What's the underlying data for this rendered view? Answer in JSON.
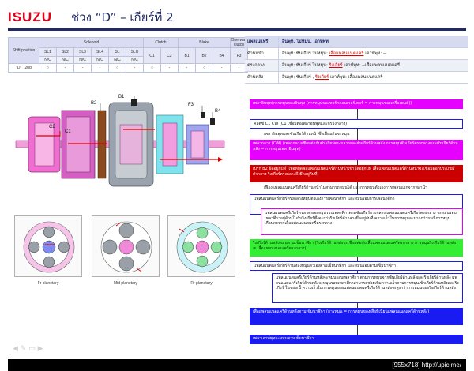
{
  "header": {
    "logo": "ISUZU",
    "title": "ช่วง “D” – เกียร์ที่ 2"
  },
  "shift_table": {
    "shift_position_label": "Shift position",
    "groups": {
      "solenoid": "Solenoid",
      "clutch": "Clutch",
      "blake": "Blake",
      "oneway": "One-way clutch"
    },
    "sub_solenoids": [
      "SL1",
      "SL2",
      "SL3",
      "SL4",
      "SL",
      "SLU"
    ],
    "sub_clutch": [
      "C1",
      "C2"
    ],
    "sub_blake": [
      "B1",
      "B2",
      "B4"
    ],
    "sub_oneway": [
      "F3"
    ],
    "nc_row": [
      "N/C",
      "N/C",
      "N/C",
      "N/C",
      "N/C",
      "N/C"
    ],
    "row": {
      "pos": "\"D\"",
      "gear": "2nd",
      "cells": [
        "○",
        "-",
        "-",
        "-",
        "○",
        "-",
        "○",
        "-",
        "-",
        "○",
        "-",
        "-"
      ]
    }
  },
  "diagram": {
    "labels": [
      "B2",
      "B1",
      "F3",
      "B4",
      "C2",
      "C1"
    ],
    "captions": [
      "Fr planetary",
      "Mid planetary",
      "Rr planetary"
    ]
  },
  "right_table": {
    "head": {
      "k": "แพลเนแทรี",
      "v": "อินพุท, ไม่หมุน, เอาท์พุท"
    },
    "rows": [
      {
        "k": "ด้านหน้า",
        "pre": "อินพุท: ซันเกียร์   ไม่หมุน: ",
        "red": "เสื้อแพลนแนตแครี่",
        "post": "   เอาท์พุท: --"
      },
      {
        "k": "ตรงกลาง",
        "pre": "อินพุท: ซันเกียร์   ไม่หมุน: ",
        "red": "ริงเกียร์",
        "post": "  เอาท์พุท: --เสื้อแพลนแนตแครี่"
      },
      {
        "k": "ด้านหลัง",
        "pre": "อินพุท: ซันเกียร์ , ",
        "red": "ริงเกียร์",
        "post": "   เอาท์พุท: เสื้อแพลนแนตแครี่"
      }
    ]
  },
  "flow": {
    "b1": "เพลาอินพุท(การหมุนของอินพุท (การหมุนของทอร์กคอนเวอร์เตอร์ = การหมุนของเครื่องยนต์))",
    "b2": "คลัตช์ C1 CW (C1 เชื่อมต่อเพลาอินพุทและกรองกลาง)",
    "n1": "เพลาอินพุทและซันเกียร์ด้านหน้าซึ่งเชื่อมกันจะหมุน",
    "b3": "เพลากลาง (CW) (เพลากลางเชื่อมต่อกับซันเกียร์ตรงกลางและซันเกียร์ด้านหลัง การหมุนซันเกียร์ตรงกลางและซันเกียร์ด้านหลัง = การหมุนเพลาอินพุท)",
    "b4": "เบรก B2 ยึดอยู่กับที่ (เพื่อหยุดพลแพลนแนตแครี่ด้านหน้าเข้ายึดอยู่กับที่ เสื้อแพลนแนตแครี่ด้านหน้าจะเชื่อมต่อกับริงเกียร์ตัวกลาง ริงเกียร์ตรงกลางถึงยึดอยู่กับที่)",
    "n2": "เฟืองแพลนแนตแครี่เกียร์ด้านหน้าไม่สามารถหมุนได้ และการหมุนตัวเองการเพลนแรกจากพลาน้ำ",
    "b5": "แพลนแนตแครี่เกียร์ตรงกลางหมุนตัวเองการเพลนาศึกา และหมุนรอบการเพลนาศึกา",
    "n3": "แพลนแนตแครี่เกียร์ตรงกลางจะหมุนรอบเพลาศึกาตามซันเกียร์ตรงกลาง แพลนแนตแครี่เกียร์ตรงกลาง จะหมุนรอบเพลาศึกาอยู่ด้านในกับริงเกียร์ซึ่งจะกว่าริงเกียร์ตัวกลางยึดอยู่กับที่ ความเร็วในการหมุนจะมากกว่ากรณีการหมุนเกือบคงจากเสื้อแพลนแนตแครี่ตรงกลาง",
    "b6": "ริงเกียร์ด้านหลังหมุนตามเข็มนาฬิกา (ริงเกียร์ด้านหลังจะเชื่อมต่อกับเสื้อแพลนแนตแครี่ตรงกลาง การหมุนริงเกียร์ด้านหลัง = เสื้อแพลนแนตแครี่ตรงกลาง)",
    "b7": "แพลนแนตแครี่เกียร์ด้านหลังหมุนตัวเองตามเข็มนาฬิกา และหมุนรอบตามเข็มนาฬิกา",
    "n4": "แพลนแนตแครี่เกียร์ด้านหลังจะหมุนรอบเพลาศึกา ตามการหมุนจากซันเกียร์ด้านหลังและริงเกียร์ด้านหลัง แพลนแนตแครี่เกียร์ด้านหลังจะหมุนรอบเพลาศึกาสามารถช่วยเพิ่มความเร็วตามการหมุนเข้าเกียร์ด้านหลังและริงเกียร์ ในขณะนี้ ความเร็วในการหมุนของแพลนแนตแครี่เกียร์ด้านหลังจะสูงกว่าการหมุนของริงเกียร์ด้านหลัง",
    "b8": "เสื้อแพลนแนตแครี่ด้านหลังตามเข็มนาฬิกา (การหมุน = การหมุนของเสื้อพีเนียนแพลนแนตแครี่ด้านหลัง)",
    "b9": "เพลาเอาท์พุทจะหมุนตามเข็มนาฬิกา"
  },
  "footer": {
    "text": "[955x718] http://upic.me/"
  },
  "colors": {
    "brand": "#e3001b",
    "navy": "#1f2a66",
    "blue": "#1a1af2",
    "magenta": "#e600ff",
    "green": "#33ee33"
  }
}
